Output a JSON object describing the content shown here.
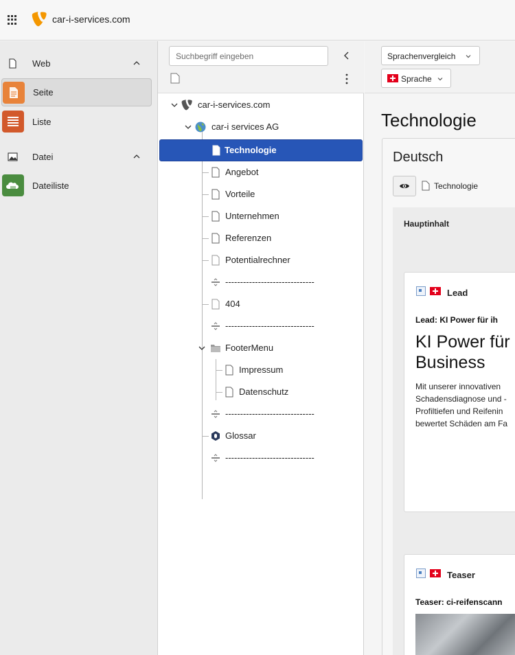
{
  "topbar": {
    "site_name": "car-i-services.com"
  },
  "modules": {
    "web_label": "Web",
    "seite_label": "Seite",
    "liste_label": "Liste",
    "datei_label": "Datei",
    "dateiliste_label": "Dateiliste"
  },
  "tree": {
    "search_placeholder": "Suchbegriff eingeben",
    "root_label": "car-i-services.com",
    "site_label": "car-i services AG",
    "technologie": "Technologie",
    "angebot": "Angebot",
    "vorteile": "Vorteile",
    "unternehmen": "Unternehmen",
    "referenzen": "Referenzen",
    "potentialrechner": "Potentialrechner",
    "divider": "------------------------------",
    "p404": "404",
    "footermenu": "FooterMenu",
    "impressum": "Impressum",
    "datenschutz": "Datenschutz",
    "glossar": "Glossar"
  },
  "content": {
    "language_compare": "Sprachenvergleich",
    "language_select": "Sprache",
    "page_title": "Technologie",
    "language_title": "Deutsch",
    "breadcrumb_page": "Technologie",
    "column_title": "Hauptinhalt",
    "lead": {
      "type": "Lead",
      "subtitle": "Lead: KI Power für ih",
      "headline_1": "KI Power für",
      "headline_2": "Business",
      "body_1": "Mit unserer innovativen",
      "body_2": "Schadensdiagnose und -",
      "body_3": "Profiltiefen und Reifenin",
      "body_4": "bewertet Schäden am Fa"
    },
    "teaser": {
      "type": "Teaser",
      "subtitle": "Teaser: ci-reifenscann"
    }
  },
  "colors": {
    "selected_bg": "#2756b7",
    "seite_icon": "#e8833a",
    "liste_icon": "#d2592b",
    "dateiliste_icon": "#4a8c3f",
    "typo3_orange": "#f49700"
  }
}
